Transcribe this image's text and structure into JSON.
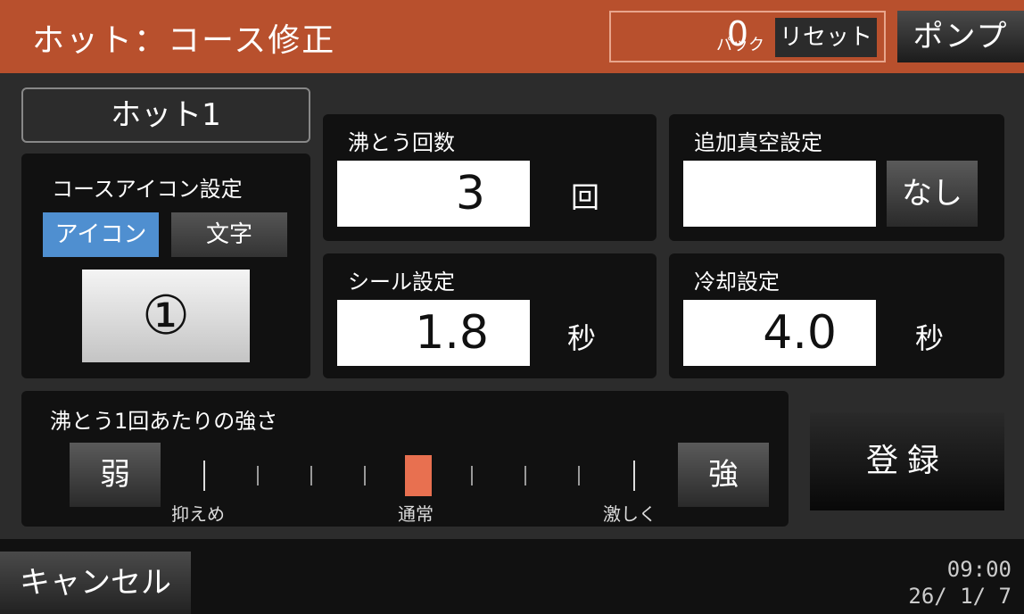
{
  "header": {
    "title": "ホット：コース修正",
    "pack_count": "0",
    "pack_unit": "パック",
    "reset_label": "リセット",
    "pump_label": "ポンプ"
  },
  "course": {
    "name": "ホット1"
  },
  "icon_settings": {
    "label": "コースアイコン設定",
    "tab_icon": "アイコン",
    "tab_text": "文字",
    "selected_tab": "アイコン",
    "icon_value": "①"
  },
  "boil_count": {
    "label": "沸とう回数",
    "value": "3",
    "unit": "回"
  },
  "extra_vacuum": {
    "label": "追加真空設定",
    "value": "",
    "button_label": "なし"
  },
  "seal": {
    "label": "シール設定",
    "value": "1.8",
    "unit": "秒"
  },
  "cooling": {
    "label": "冷却設定",
    "value": "4.0",
    "unit": "秒"
  },
  "strength": {
    "label": "沸とう1回あたりの強さ",
    "weak_label": "弱",
    "strong_label": "強",
    "low_label": "抑えめ",
    "mid_label": "通常",
    "high_label": "激しく",
    "steps": 9,
    "selected_step": 5
  },
  "actions": {
    "register_label": "登録",
    "cancel_label": "キャンセル"
  },
  "status": {
    "time": "09:00",
    "date": "26/ 1/ 7"
  },
  "colors": {
    "header": "#b8502d",
    "accent_tab": "#4f8fd0",
    "slider_marker": "#e87050"
  }
}
